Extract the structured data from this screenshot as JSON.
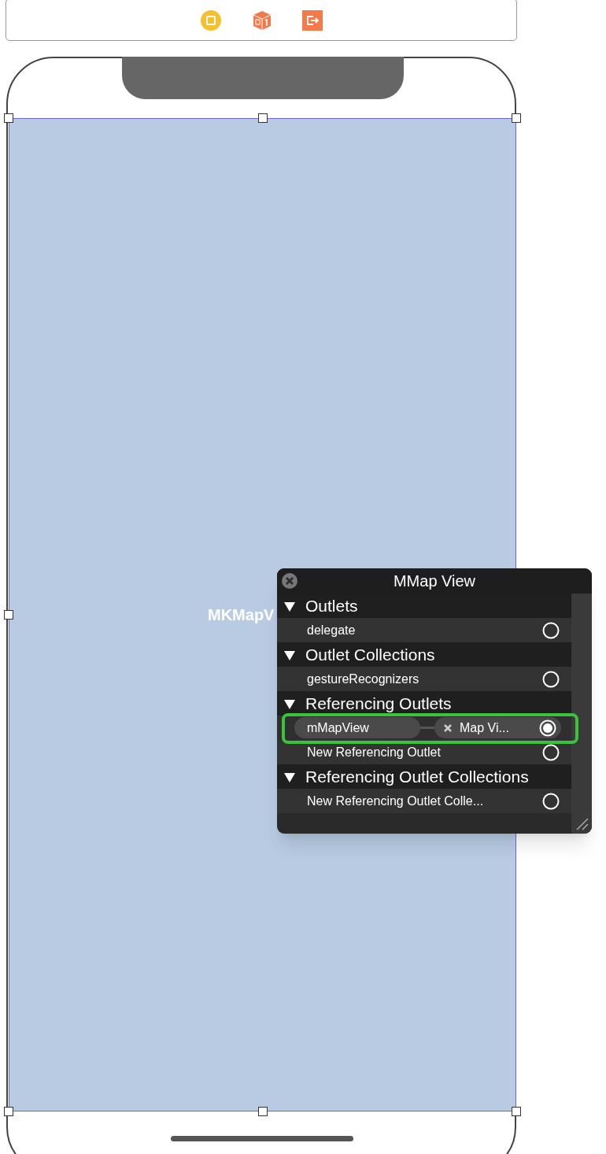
{
  "toolbar": {
    "items": [
      {
        "kind": "circle"
      },
      {
        "kind": "cube"
      },
      {
        "kind": "exit"
      }
    ]
  },
  "canvas": {
    "view_label": "MKMapV"
  },
  "popup": {
    "title": "MMap View",
    "sections": [
      {
        "header": "Outlets",
        "expanded": true,
        "items": [
          {
            "kind": "outlet",
            "label": "delegate",
            "connected": false
          }
        ]
      },
      {
        "header": "Outlet Collections",
        "expanded": true,
        "items": [
          {
            "kind": "outlet",
            "label": "gestureRecognizers",
            "connected": false
          }
        ]
      },
      {
        "header": "Referencing Outlets",
        "expanded": true,
        "items": [
          {
            "kind": "connection",
            "source": "mMapView",
            "target": "Map Vi...",
            "connected": true,
            "highlighted": true
          },
          {
            "kind": "outlet",
            "label": "New Referencing Outlet",
            "connected": false
          }
        ]
      },
      {
        "header": "Referencing Outlet Collections",
        "expanded": true,
        "items": [
          {
            "kind": "outlet",
            "label": "New Referencing Outlet Colle...",
            "connected": false
          }
        ]
      }
    ]
  }
}
